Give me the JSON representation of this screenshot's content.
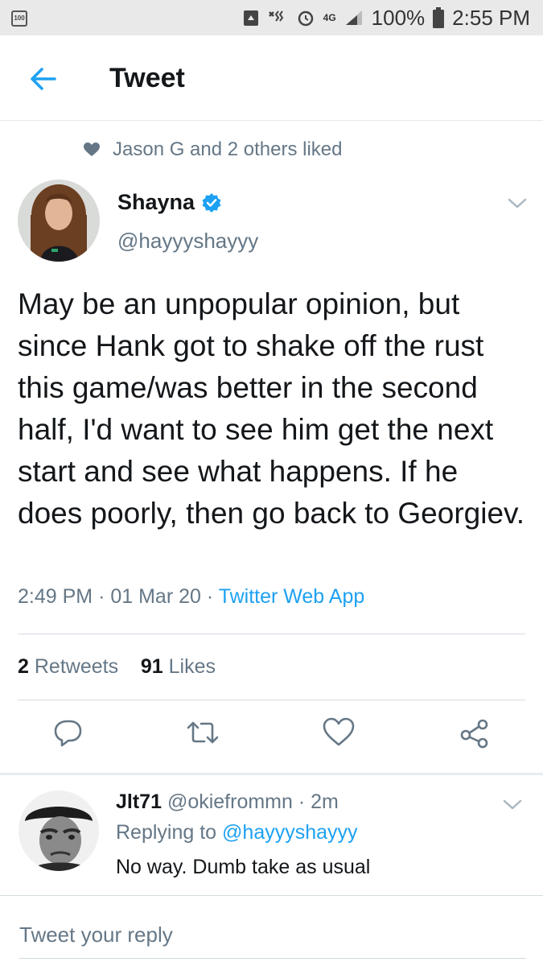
{
  "status_bar": {
    "left_badge": "100",
    "network": "4G",
    "battery": "100%",
    "time": "2:55 PM",
    "icons": [
      "recycle-icon",
      "vibrate-icon",
      "alarm-icon",
      "signal-icon",
      "battery-icon"
    ]
  },
  "header": {
    "title": "Tweet",
    "back_icon": "arrow-left-icon"
  },
  "liked": {
    "text": "Jason G and 2 others liked",
    "icon": "heart-icon"
  },
  "tweet": {
    "author_name": "Shayna",
    "verified": true,
    "handle": "@hayyyshayyy",
    "text": "May be an unpopular opinion, but since Hank got to shake off the rust this game/was better in the second half, I'd want to see him get the next start and see what happens. If he does poorly, then go back to Georgiev.",
    "time": "2:49 PM",
    "separator": "·",
    "date": "01 Mar 20",
    "app": "Twitter Web App",
    "retweets_count": "2",
    "retweets_label": "Retweets",
    "likes_count": "91",
    "likes_label": "Likes"
  },
  "actions": [
    "reply-icon",
    "retweet-icon",
    "like-icon",
    "share-icon"
  ],
  "reply": {
    "author_name": "Jlt71",
    "handle": "@okiefrommn",
    "separator": "·",
    "age": "2m",
    "replying_label": "Replying to",
    "replying_to": "@hayyyshayyy",
    "text": "No way. Dumb take as usual"
  },
  "compose": {
    "placeholder": "Tweet your reply"
  },
  "colors": {
    "accent": "#1da1f2",
    "secondary_text": "#657786",
    "primary_text": "#14171a",
    "divider": "#e1e8ed"
  }
}
